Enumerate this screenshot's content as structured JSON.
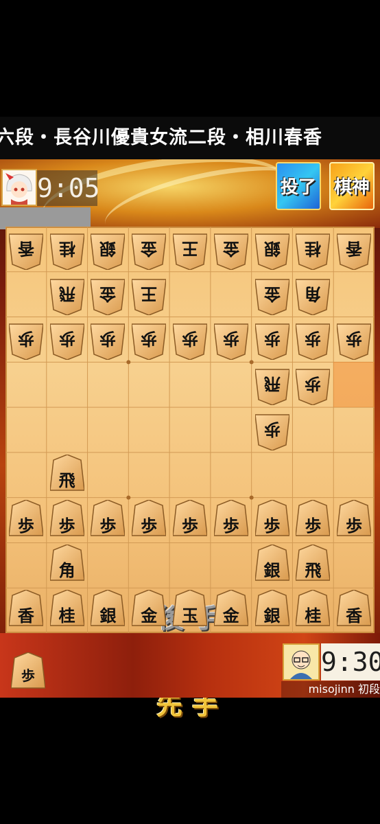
{
  "banner": {
    "text": "六段・長谷川優貴女流二段・相川春香"
  },
  "opponent": {
    "clock": "9:05"
  },
  "buttons": {
    "resign": "投了",
    "shogi_god": "棋神"
  },
  "labels": {
    "gote": "後手",
    "sente": "先手"
  },
  "player": {
    "clock": "9:30",
    "name": "misojinn 初段"
  },
  "hand": {
    "sente": [
      "歩"
    ]
  },
  "last_move_square": [
    8,
    3
  ],
  "board": [
    [
      "香",
      "桂",
      "銀",
      "金",
      "王",
      "金",
      "銀",
      "桂",
      "香"
    ],
    [
      "",
      "飛",
      "金",
      "王",
      "",
      "",
      "金",
      "角",
      ""
    ],
    [
      "歩",
      "歩",
      "歩",
      "歩",
      "歩",
      "歩",
      "歩",
      "歩",
      "歩"
    ],
    [
      "",
      "",
      "",
      "",
      "",
      "",
      "飛",
      "歩",
      ""
    ],
    [
      "",
      "",
      "",
      "",
      "",
      "",
      "歩",
      "",
      ""
    ],
    [
      "",
      "飛",
      "",
      "",
      "",
      "",
      "",
      "",
      ""
    ],
    [
      "歩",
      "歩",
      "歩",
      "歩",
      "歩",
      "歩",
      "歩",
      "歩",
      "歩"
    ],
    [
      "",
      "角",
      "",
      "",
      "",
      "",
      "銀",
      "飛",
      ""
    ],
    [
      "香",
      "桂",
      "銀",
      "金",
      "玉",
      "金",
      "銀",
      "桂",
      "香"
    ]
  ],
  "owners": [
    [
      "g",
      "g",
      "g",
      "g",
      "g",
      "g",
      "g",
      "g",
      "g"
    ],
    [
      "",
      "g",
      "g",
      "g",
      "",
      "",
      "g",
      "g",
      ""
    ],
    [
      "g",
      "g",
      "g",
      "g",
      "g",
      "g",
      "g",
      "g",
      "g"
    ],
    [
      "",
      "",
      "",
      "",
      "",
      "",
      "g",
      "g",
      ""
    ],
    [
      "",
      "",
      "",
      "",
      "",
      "",
      "g",
      "",
      ""
    ],
    [
      "",
      "s",
      "",
      "",
      "",
      "",
      "",
      "",
      ""
    ],
    [
      "s",
      "s",
      "s",
      "s",
      "s",
      "s",
      "s",
      "s",
      "s"
    ],
    [
      "",
      "s",
      "",
      "",
      "",
      "",
      "s",
      "s",
      ""
    ],
    [
      "s",
      "s",
      "s",
      "s",
      "s",
      "s",
      "s",
      "s",
      "s"
    ]
  ]
}
